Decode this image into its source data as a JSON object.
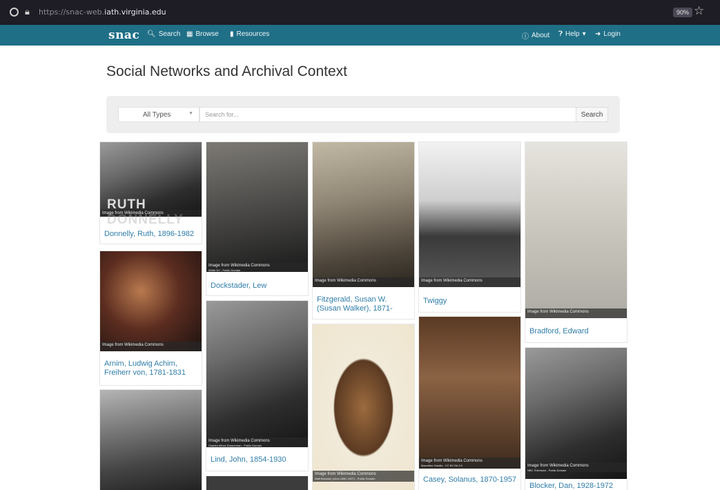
{
  "browser": {
    "url_prefix": "https://snac-web.",
    "url_host": "iath.virginia.edu",
    "zoom": "90%"
  },
  "navbar": {
    "brand": "snac",
    "search": "Search",
    "browse": "Browse",
    "resources": "Resources",
    "about": "About",
    "help": "Help",
    "login": "Login"
  },
  "page_title": "Social Networks and Archival Context",
  "search": {
    "type_value": "All Types",
    "placeholder": "Search for...",
    "button": "Search"
  },
  "cards": [
    {
      "name": "Donnelly, Ruth, 1896-1982",
      "caption": "Image from Wikimedia Commons",
      "overlay": "RUTH DONNELLY"
    },
    {
      "name": "Arnim, Ludwig Achim, Freiherr von, 1781-1831",
      "caption": "Image from Wikimedia Commons"
    },
    {
      "name": "Dockstader, Lew",
      "caption": "Image from Wikimedia Commons",
      "credit": "White NY - Public Domain"
    },
    {
      "name": "Lind, John, 1854-1930",
      "caption": "Image from Wikimedia Commons",
      "credit": "Charles Alfred Zimmerman - Public Domain"
    },
    {
      "name": "Fitzgerald, Susan W. (Susan Walker), 1871-",
      "caption": "Image from Wikimedia Commons"
    },
    {
      "caption": "Image from Wikimedia Commons",
      "credit": "Walt Brewster (circa 1880–1927) - Public Domain"
    },
    {
      "name": "Twiggy",
      "caption": "Image from Wikimedia Commons"
    },
    {
      "name": "Casey, Solanus, 1870-1957",
      "caption": "Image from Wikimedia Commons",
      "credit": "Marcelino Gandia - CC BY-SA 3.0"
    },
    {
      "name": "Bradford, Edward",
      "caption": "Image from Wikimedia Commons"
    },
    {
      "name": "Blocker, Dan, 1928-1972",
      "caption": "Image from Wikimedia Commons",
      "credit": "NBC Television - Public Domain"
    }
  ]
}
